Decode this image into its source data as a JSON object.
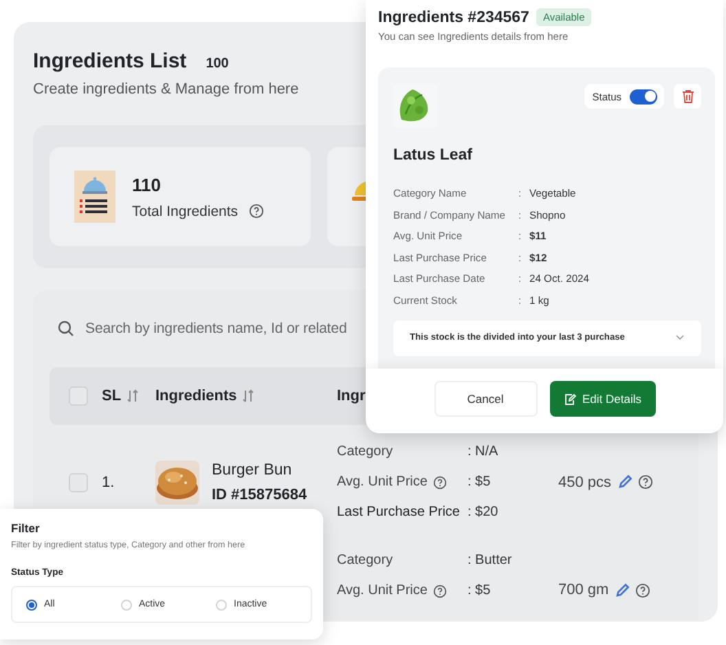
{
  "page": {
    "title": "Ingredients List",
    "count": "100",
    "subtitle": "Create ingredients & Manage from here"
  },
  "stats": [
    {
      "kind": "menu",
      "value": "110",
      "label": "Total Ingredients"
    },
    {
      "kind": "bowl"
    }
  ],
  "search": {
    "placeholder": "Search by ingredients name, Id or related"
  },
  "table": {
    "all_checked": false,
    "columns": [
      {
        "label": "SL",
        "sortable": true
      },
      {
        "label": "Ingredients",
        "sortable": true
      },
      {
        "label": "Ingr"
      }
    ],
    "rows": [
      {
        "checked": false,
        "sl": "1.",
        "name": "Burger Bun",
        "id": "ID #15875684",
        "stock": "450 pcs",
        "details": [
          {
            "label": "Category",
            "value": ": N/A",
            "help": false,
            "strong": false
          },
          {
            "label": "Avg. Unit Price",
            "value": ": $5",
            "help": true,
            "strong": false
          },
          {
            "label": "Last Purchase Price",
            "value": ": $20",
            "help": false,
            "strong": true
          }
        ]
      },
      {
        "stock": "700 gm",
        "details": [
          {
            "label": "Category",
            "value": ": Butter",
            "help": false,
            "strong": false
          },
          {
            "label": "Avg. Unit Price",
            "value": ": $5",
            "help": true,
            "strong": false
          }
        ]
      }
    ]
  },
  "modal": {
    "title": "Ingredients #234567",
    "badge": "Available",
    "subtitle": "You can see Ingredients details from here",
    "item": {
      "name": "Latus Leaf",
      "status_label": "Status",
      "status_on": true,
      "details": [
        {
          "label": "Category Name",
          "separator": ":",
          "value": "Vegetable",
          "strong": false
        },
        {
          "label": "Brand / Company Name",
          "separator": ":",
          "value": "Shopno",
          "strong": false
        },
        {
          "label": "Avg. Unit  Price",
          "separator": ":",
          "value": "$11",
          "strong": true
        },
        {
          "label": "Last Purchase Price",
          "separator": ":",
          "value": "$12",
          "strong": true
        },
        {
          "label": "Last Purchase Date",
          "separator": ":",
          "value": "24 Oct. 2024",
          "strong": false
        },
        {
          "label": "Current Stock",
          "separator": ":",
          "value": "1 kg",
          "strong": false
        }
      ],
      "note": "This stock is the divided into your last 3 purchase",
      "expanded": false
    },
    "buttons": [
      {
        "label": "Cancel",
        "kind": "secondary"
      },
      {
        "label": "Edit Details",
        "kind": "primary"
      }
    ]
  },
  "filter": {
    "title": "Filter",
    "subtitle": "Filter by ingredient status type, Category and other from here",
    "group_label": "Status Type",
    "options": [
      {
        "label": "All",
        "selected": true
      },
      {
        "label": "Active",
        "selected": false
      },
      {
        "label": "Inactive",
        "selected": false
      }
    ]
  }
}
